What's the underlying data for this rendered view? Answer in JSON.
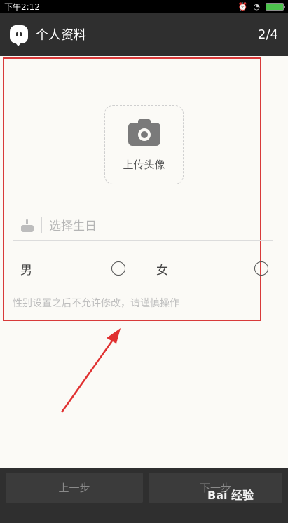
{
  "status_bar": {
    "time": "下午2:12"
  },
  "app_bar": {
    "title": "个人资料",
    "page_counter": "2/4"
  },
  "avatar": {
    "upload_label": "上传头像"
  },
  "birthday": {
    "placeholder": "选择生日"
  },
  "gender": {
    "male_label": "男",
    "female_label": "女",
    "hint": "性别设置之后不允许修改，请谨慎操作"
  },
  "footer": {
    "prev_label": "上一步",
    "next_label": "下一步"
  },
  "watermark": "Bai 经验",
  "colors": {
    "highlight_border": "#d83a3a",
    "toolbar": "#2f2f2f",
    "background": "#fbfaf6"
  }
}
